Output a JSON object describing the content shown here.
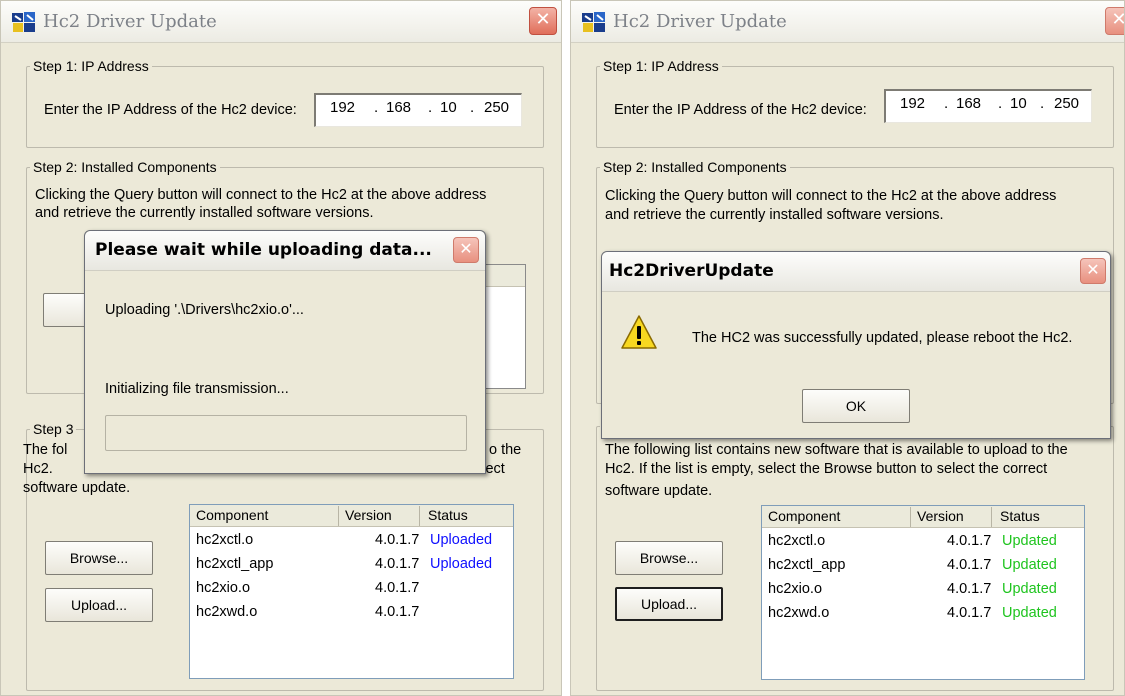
{
  "window_title": "Hc2 Driver Update",
  "step1": {
    "legend": "Step 1: IP Address",
    "prompt": "Enter the IP Address of the Hc2 device:",
    "ip": [
      "192",
      "168",
      "10",
      "250"
    ]
  },
  "step2": {
    "legend": "Step 2: Installed Components",
    "line1": "Clicking the Query button will connect to the Hc2 at the above address",
    "line2": "and retrieve the currently installed software versions."
  },
  "step3": {
    "legend_partial": "Step 3",
    "line1_partial": "The fol",
    "line1_tail": "o the",
    "line2_head": "Hc2.",
    "line2_tail": "ct the correct",
    "line3": "software update.",
    "right_line1": "The following list contains new software that is available to upload to the",
    "right_line2": "Hc2.  If the list is empty, select the Browse button to select the correct",
    "browse_label": "Browse...",
    "upload_label": "Upload..."
  },
  "list_headers": [
    "Component",
    "Version",
    "Status"
  ],
  "left_rows": [
    {
      "component": "hc2xctl.o",
      "version": "4.0.1.7",
      "status": "Uploaded"
    },
    {
      "component": "hc2xctl_app",
      "version": "4.0.1.7",
      "status": "Uploaded"
    },
    {
      "component": "hc2xio.o",
      "version": "4.0.1.7",
      "status": ""
    },
    {
      "component": "hc2xwd.o",
      "version": "4.0.1.7",
      "status": ""
    }
  ],
  "right_rows": [
    {
      "component": "hc2xctl.o",
      "version": "4.0.1.7",
      "status": "Updated"
    },
    {
      "component": "hc2xctl_app",
      "version": "4.0.1.7",
      "status": "Updated"
    },
    {
      "component": "hc2xio.o",
      "version": "4.0.1.7",
      "status": "Updated"
    },
    {
      "component": "hc2xwd.o",
      "version": "4.0.1.7",
      "status": "Updated"
    }
  ],
  "progress_dialog": {
    "title": "Please wait while uploading data...",
    "file_text": "Uploading '.\\Drivers\\hc2xio.o'...",
    "status_text": "Initializing file transmission..."
  },
  "success_dialog": {
    "title": "Hc2DriverUpdate",
    "message": "The HC2 was successfully updated, please reboot the Hc2.",
    "ok_label": "OK"
  },
  "colors": {
    "uploaded": "#1010ff",
    "updated": "#1ec41e",
    "window_bg": "#ece9d8"
  },
  "icons": {
    "app": "app-icon",
    "close": "close-icon",
    "warning": "warning-icon"
  }
}
